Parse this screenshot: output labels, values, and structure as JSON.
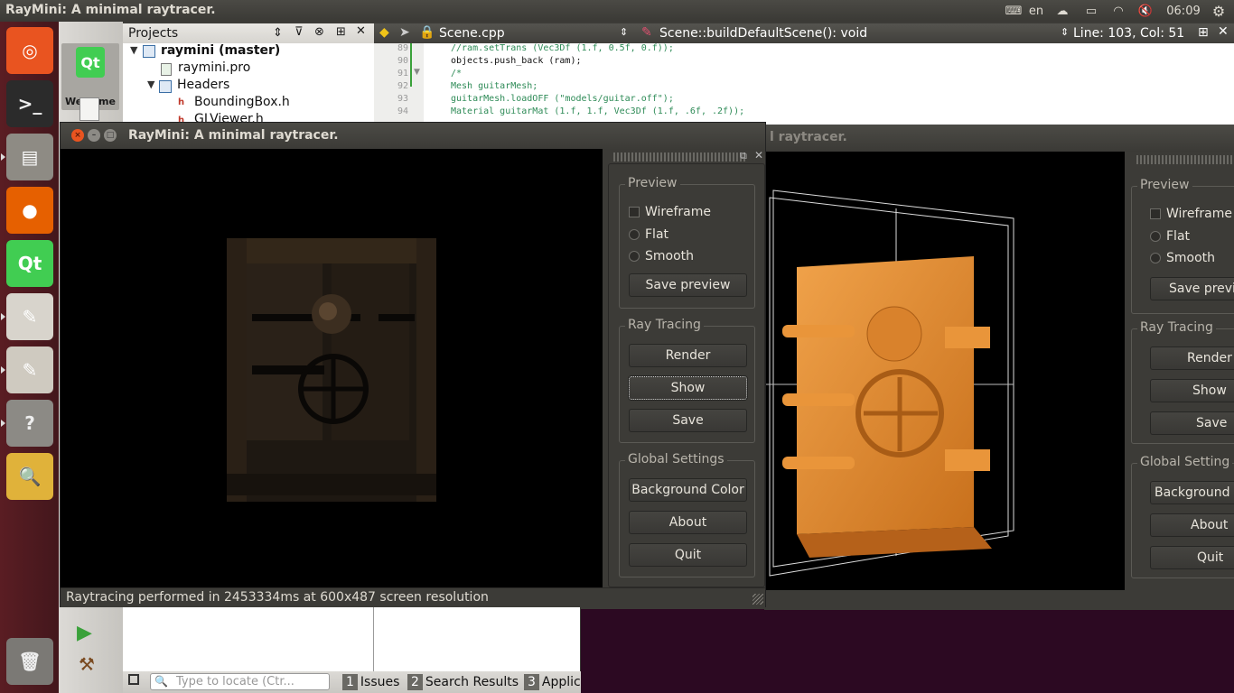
{
  "top_panel": {
    "title": "RayMini: A minimal raytracer.",
    "keyboard_icon": "keyboard-icon",
    "language": "en",
    "time": "06:09"
  },
  "launcher": {
    "items": [
      {
        "name": "ubuntu-dash",
        "glyph": "◎",
        "color": "#e95420"
      },
      {
        "name": "terminal",
        "glyph": ">_",
        "color": "#2b2b2b"
      },
      {
        "name": "files",
        "glyph": "▤",
        "color": "#8e8b84"
      },
      {
        "name": "firefox",
        "glyph": "●",
        "color": "#e66000"
      },
      {
        "name": "qt-creator",
        "glyph": "Qt",
        "color": "#41cd52"
      },
      {
        "name": "document-viewer",
        "glyph": "✎",
        "color": "#d8d4cc"
      },
      {
        "name": "text-editor",
        "glyph": "✎",
        "color": "#cfcac0"
      },
      {
        "name": "help",
        "glyph": "?",
        "color": "#8c8a85"
      },
      {
        "name": "image-viewer",
        "glyph": "🔍",
        "color": "#e0b23a"
      },
      {
        "name": "trash",
        "glyph": "🗑",
        "color": "#7b7975"
      }
    ]
  },
  "qtcreator": {
    "mode_welcome": "Welcome",
    "mode_logo": "Qt",
    "projects_label": "Projects",
    "tree": [
      {
        "label": "raymini (master)",
        "bold": true
      },
      {
        "label": "raymini.pro"
      },
      {
        "label": "Headers"
      },
      {
        "label": "BoundingBox.h"
      },
      {
        "label": "GLViewer.h"
      }
    ],
    "file_name": "Scene.cpp",
    "function_name": "Scene::buildDefaultScene(): void",
    "cursor_pos": "Line: 103, Col: 51",
    "code_lines": [
      {
        "num": "89",
        "text": "//ram.setTrans (Vec3Df (1.f, 0.5f, 0.f));"
      },
      {
        "num": "90",
        "text": "objects.push_back (ram);"
      },
      {
        "num": "91",
        "text": "/*"
      },
      {
        "num": "92",
        "text": "Mesh guitarMesh;"
      },
      {
        "num": "93",
        "text": "guitarMesh.loadOFF (\"models/guitar.off\");"
      },
      {
        "num": "94",
        "text": "Material guitarMat (1.f, 1.f, Vec3Df (1.f, .6f, .2f));"
      }
    ],
    "locate_placeholder": "Type to locate (Ctr...",
    "bottom_tabs": [
      {
        "num": "1",
        "label": "Issues"
      },
      {
        "num": "2",
        "label": "Search Results"
      },
      {
        "num": "3",
        "label": "Applic"
      }
    ]
  },
  "back_window": {
    "title": "RayMini: A minimal raytracer.",
    "title_fragment": "l raytracer.",
    "preview_group": "Preview",
    "options": [
      "Wireframe",
      "Flat",
      "Smooth"
    ],
    "save_preview": "Save previ",
    "raytracing_group": "Ray Tracing",
    "render": "Render",
    "show": "Show",
    "save": "Save",
    "global_group": "Global Setting",
    "background_color": "Background C",
    "about": "About",
    "quit": "Quit"
  },
  "front_window": {
    "title": "RayMini: A minimal raytracer.",
    "preview_group": "Preview",
    "wireframe": "Wireframe",
    "flat": "Flat",
    "smooth": "Smooth",
    "save_preview": "Save preview",
    "raytracing_group": "Ray Tracing",
    "render": "Render",
    "show": "Show",
    "save": "Save",
    "global_group": "Global Settings",
    "background_color": "Background Color",
    "about": "About",
    "quit": "Quit",
    "status": "Raytracing performed in 2453334ms at 600x487 screen resolution"
  },
  "colors": {
    "accent_orange": "#e8922e",
    "render_dark": "#1e1712",
    "launcher_bg": "#4e1a20"
  }
}
